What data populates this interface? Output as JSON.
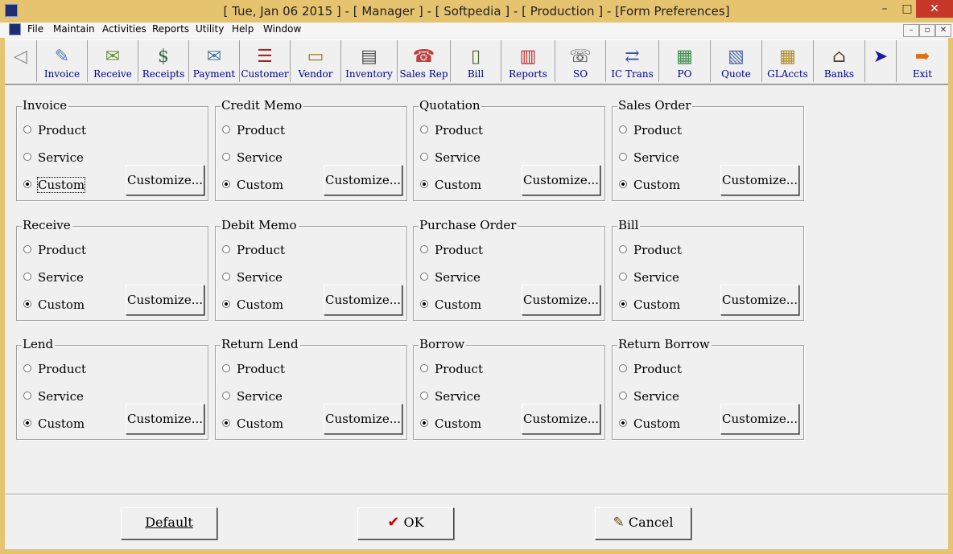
{
  "window": {
    "title": "[ Tue, Jan 06 2015 ] - [ Manager ] - [ Softpedia ] - [ Production ] - [Form Preferences]",
    "min_glyph": "–",
    "max_glyph": "□",
    "close_glyph": "✕"
  },
  "menu": {
    "items": [
      "File",
      "Maintain",
      "Activities",
      "Reports",
      "Utility",
      "Help",
      "Window"
    ],
    "mdi_min": "–",
    "mdi_restore": "▫",
    "mdi_close": "✕"
  },
  "toolbar": {
    "items": [
      {
        "label": "",
        "icon": "back-arrow-icon",
        "glyph": "◁"
      },
      {
        "label": "Invoice",
        "icon": "invoice-icon",
        "glyph": "✎"
      },
      {
        "label": "Receive",
        "icon": "receive-icon",
        "glyph": "✉"
      },
      {
        "label": "Receipts",
        "icon": "money-bag-icon",
        "glyph": "$"
      },
      {
        "label": "Payment",
        "icon": "payment-icon",
        "glyph": "✉"
      },
      {
        "label": "Customer",
        "icon": "customer-icon",
        "glyph": "☰"
      },
      {
        "label": "Vendor",
        "icon": "vendor-icon",
        "glyph": "▭"
      },
      {
        "label": "Inventory",
        "icon": "inventory-icon",
        "glyph": "▤"
      },
      {
        "label": "Sales Rep",
        "icon": "sales-rep-icon",
        "glyph": "☎"
      },
      {
        "label": "Bill",
        "icon": "bill-icon",
        "glyph": "▯"
      },
      {
        "label": "Reports",
        "icon": "reports-icon",
        "glyph": "▥"
      },
      {
        "label": "SO",
        "icon": "sales-order-icon",
        "glyph": "☏"
      },
      {
        "label": "IC Trans",
        "icon": "ic-trans-icon",
        "glyph": "⇄"
      },
      {
        "label": "PO",
        "icon": "purchase-order-icon",
        "glyph": "▦"
      },
      {
        "label": "Quote",
        "icon": "quote-icon",
        "glyph": "▧"
      },
      {
        "label": "GLAccts",
        "icon": "gl-accounts-icon",
        "glyph": "▦"
      },
      {
        "label": "Banks",
        "icon": "bank-icon",
        "glyph": "⌂"
      },
      {
        "label": "",
        "icon": "forward-arrow-icon",
        "glyph": "➤"
      },
      {
        "label": "Exit",
        "icon": "exit-arrow-icon",
        "glyph": "➡"
      }
    ]
  },
  "options": {
    "product": "Product",
    "service": "Service",
    "custom": "Custom",
    "customize": "Customize..."
  },
  "groups": [
    {
      "title": "Invoice",
      "selected": "Custom"
    },
    {
      "title": "Credit Memo",
      "selected": "Custom"
    },
    {
      "title": "Quotation",
      "selected": "Custom"
    },
    {
      "title": "Sales Order",
      "selected": "Custom"
    },
    {
      "title": "Receive",
      "selected": "Custom"
    },
    {
      "title": "Debit Memo",
      "selected": "Custom"
    },
    {
      "title": "Purchase Order",
      "selected": "Custom"
    },
    {
      "title": "Bill",
      "selected": "Custom"
    },
    {
      "title": "Lend",
      "selected": "Custom"
    },
    {
      "title": "Return Lend",
      "selected": "Custom"
    },
    {
      "title": "Borrow",
      "selected": "Custom"
    },
    {
      "title": "Return Borrow",
      "selected": "Custom"
    }
  ],
  "buttons": {
    "default": "Default",
    "ok": "OK",
    "ok_glyph": "✔",
    "cancel": "Cancel",
    "cancel_glyph": "✎"
  },
  "colors": {
    "ok_check": "#cc0000",
    "toolbar_label": "#000080"
  }
}
